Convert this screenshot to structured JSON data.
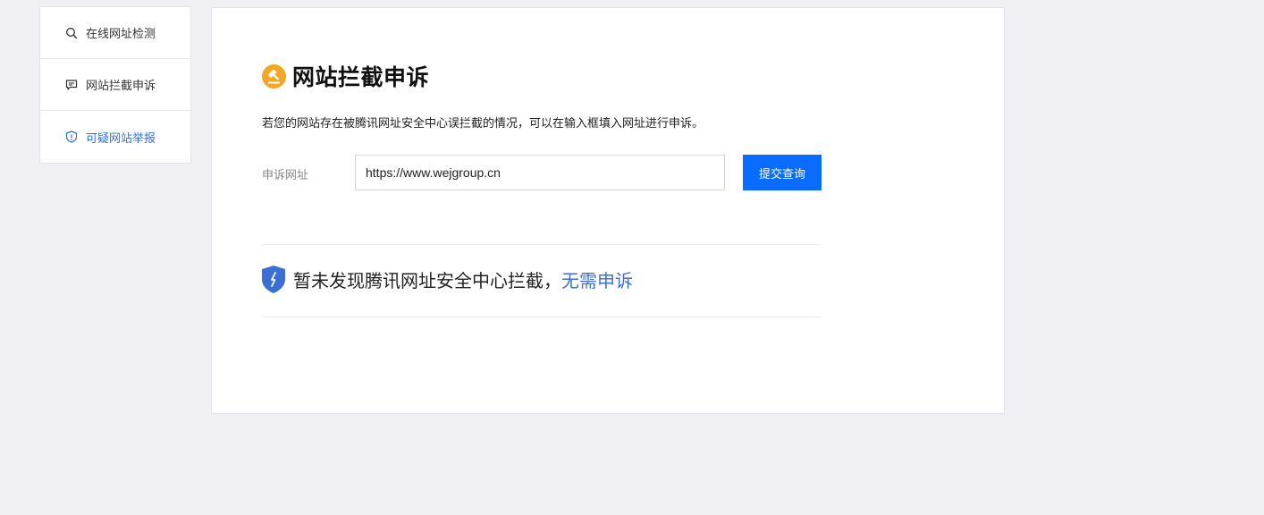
{
  "sidebar": {
    "items": [
      {
        "label": "在线网址检测",
        "icon": "search-icon",
        "active": false
      },
      {
        "label": "网站拦截申诉",
        "icon": "chat-bubble-icon",
        "active": false
      },
      {
        "label": "可疑网站举报",
        "icon": "shield-alert-icon",
        "active": true
      }
    ]
  },
  "main": {
    "title": "网站拦截申诉",
    "title_icon": "gavel-icon",
    "description": "若您的网站存在被腾讯网址安全中心误拦截的情况，可以在输入框填入网址进行申诉。",
    "form": {
      "label": "申诉网址",
      "input_value": "https://www.wejgroup.cn",
      "submit_label": "提交查询"
    },
    "result": {
      "icon": "shield-check-icon",
      "text": "暂未发现腾讯网址安全中心拦截，",
      "link": "无需申诉"
    }
  },
  "colors": {
    "page_background": "#efeff4",
    "accent_blue": "#0a6cff",
    "link_blue": "#3e6fd8",
    "title_icon_orange": "#f5a623",
    "shield_blue": "#3b6fd6"
  }
}
